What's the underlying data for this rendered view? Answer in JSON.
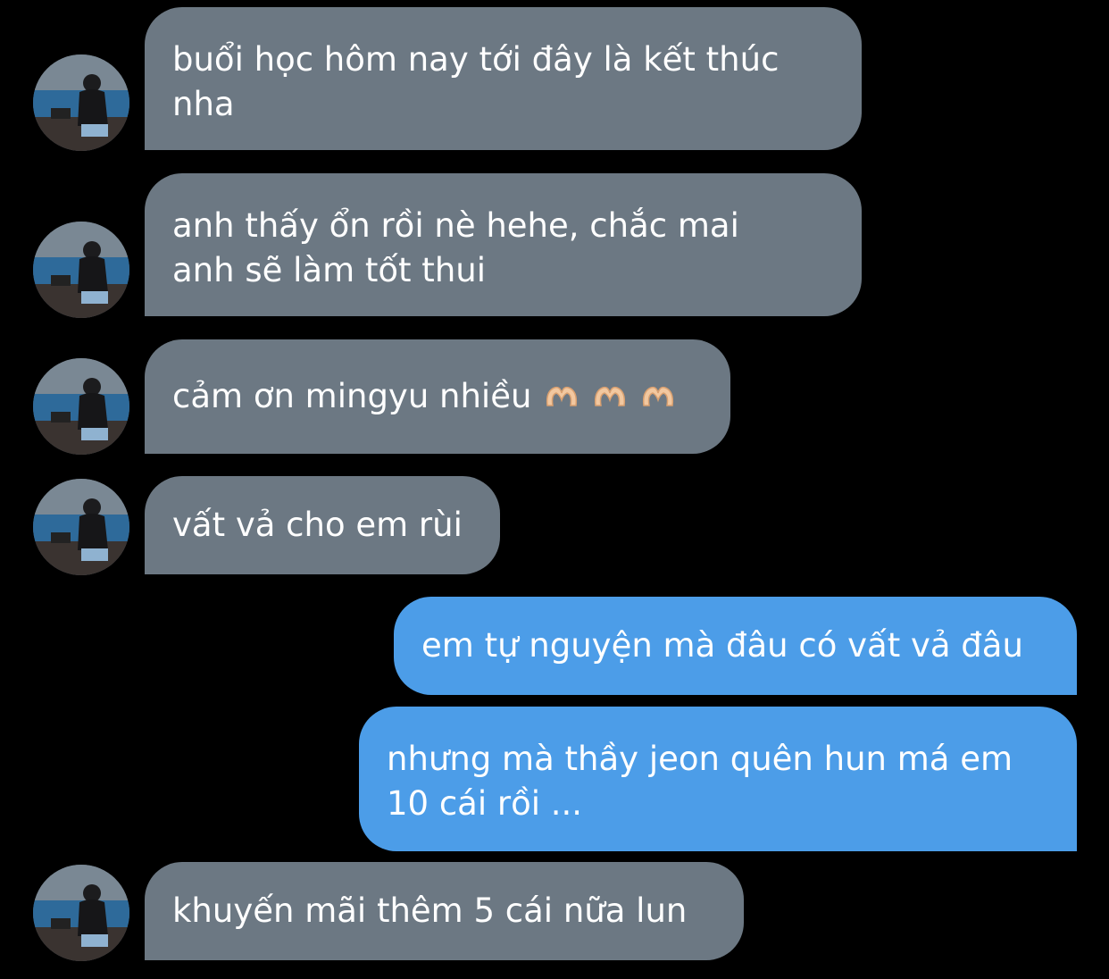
{
  "colors": {
    "background": "#000000",
    "received_bubble": "#6c7883",
    "sent_bubble": "#4c9de8",
    "text": "#ffffff"
  },
  "messages": [
    {
      "side": "received",
      "text": "buổi học hôm nay tới đây là kết thúc\nnha",
      "avatar": "profile-photo"
    },
    {
      "side": "received",
      "text": "anh thấy ổn rồi nè hehe, chắc mai\nanh sẽ làm tốt thui",
      "avatar": "profile-photo"
    },
    {
      "side": "received",
      "text": "cảm ơn mingyu nhiều",
      "emoji": [
        "heart-hands-emoji",
        "heart-hands-emoji",
        "heart-hands-emoji"
      ],
      "avatar": "profile-photo"
    },
    {
      "side": "received",
      "text": "vất vả cho em rùi",
      "avatar": "profile-photo"
    },
    {
      "side": "sent",
      "text": "em tự nguyện mà đâu có vất vả đâu"
    },
    {
      "side": "sent",
      "text": "nhưng mà thầy jeon quên hun má em\n10 cái rồi ..."
    },
    {
      "side": "received",
      "text": "khuyến mãi thêm 5 cái nữa lun",
      "avatar": "profile-photo"
    }
  ]
}
